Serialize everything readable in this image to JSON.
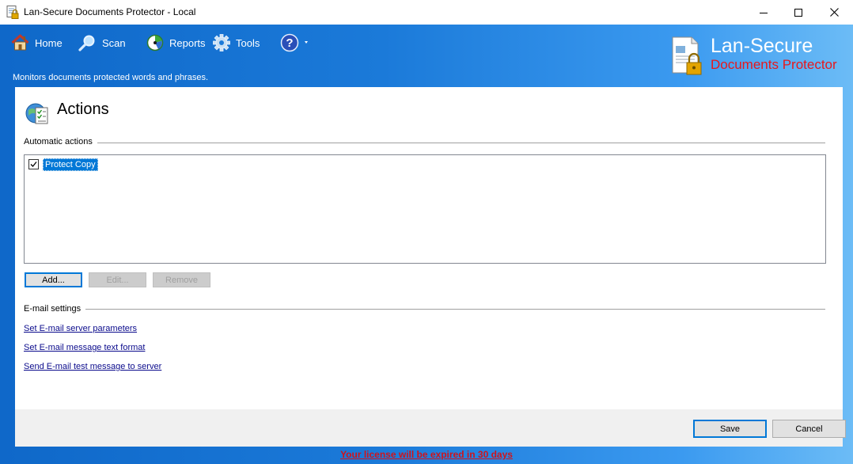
{
  "window": {
    "title": "Lan-Secure Documents Protector - Local"
  },
  "toolbar": {
    "items": [
      {
        "label": "Home",
        "icon": "home-icon"
      },
      {
        "label": "Scan",
        "icon": "search-icon"
      },
      {
        "label": "Reports",
        "icon": "reports-icon"
      },
      {
        "label": "Tools",
        "icon": "gear-icon"
      }
    ],
    "help_icon": "help-icon"
  },
  "subtitle": "Monitors documents protected words and phrases.",
  "brand": {
    "name": "Lan-Secure",
    "product": "Documents Protector"
  },
  "page": {
    "title": "Actions"
  },
  "automatic_actions": {
    "label": "Automatic actions",
    "items": [
      {
        "label": "Protect Copy",
        "checked": true,
        "selected": true
      }
    ],
    "buttons": {
      "add": "Add...",
      "edit": "Edit...",
      "remove": "Remove"
    }
  },
  "email_settings": {
    "label": "E-mail settings",
    "links": [
      "Set E-mail server parameters",
      "Set E-mail message text format",
      "Send E-mail test message to server"
    ]
  },
  "footer": {
    "save": "Save",
    "cancel": "Cancel"
  },
  "license_notice": "Your license will be expired in 30 days",
  "colors": {
    "accent_blue": "#1b7ad9",
    "selection": "#0078d7",
    "brand_red": "#e8181c",
    "license_red": "#d0141b"
  }
}
